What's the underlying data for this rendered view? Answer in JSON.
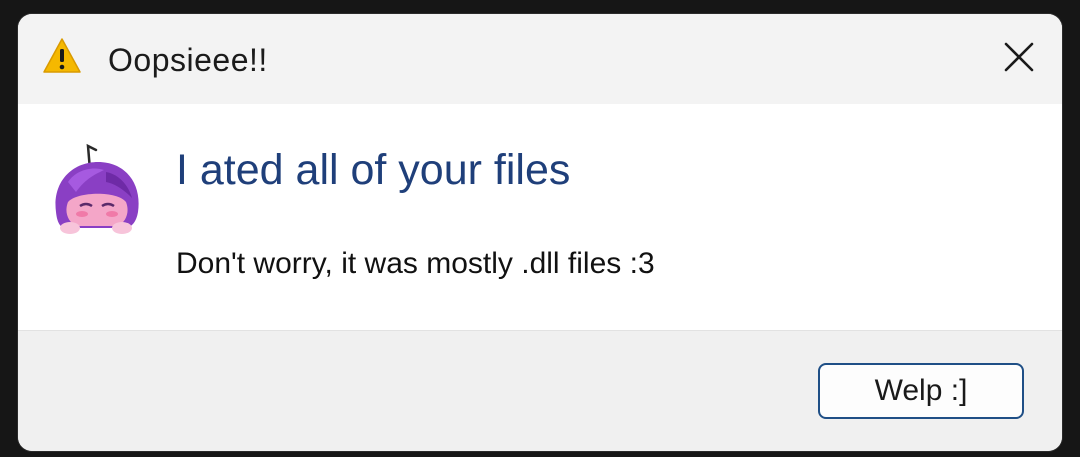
{
  "dialog": {
    "title": "Oopsieee!!",
    "main_instruction": "I ated all of your files",
    "content": "Don't worry, it was mostly .dll files :3",
    "button_label": "Welp :]"
  },
  "icons": {
    "title_icon": "warning-icon",
    "close_icon": "close-icon",
    "body_image": "mascot-image"
  },
  "colors": {
    "warning_fill": "#f5b800",
    "main_instruction": "#1f3f7a",
    "button_border": "#1f4f86",
    "mascot_hair": "#8a3fc4",
    "mascot_face": "#f4a6c8"
  }
}
